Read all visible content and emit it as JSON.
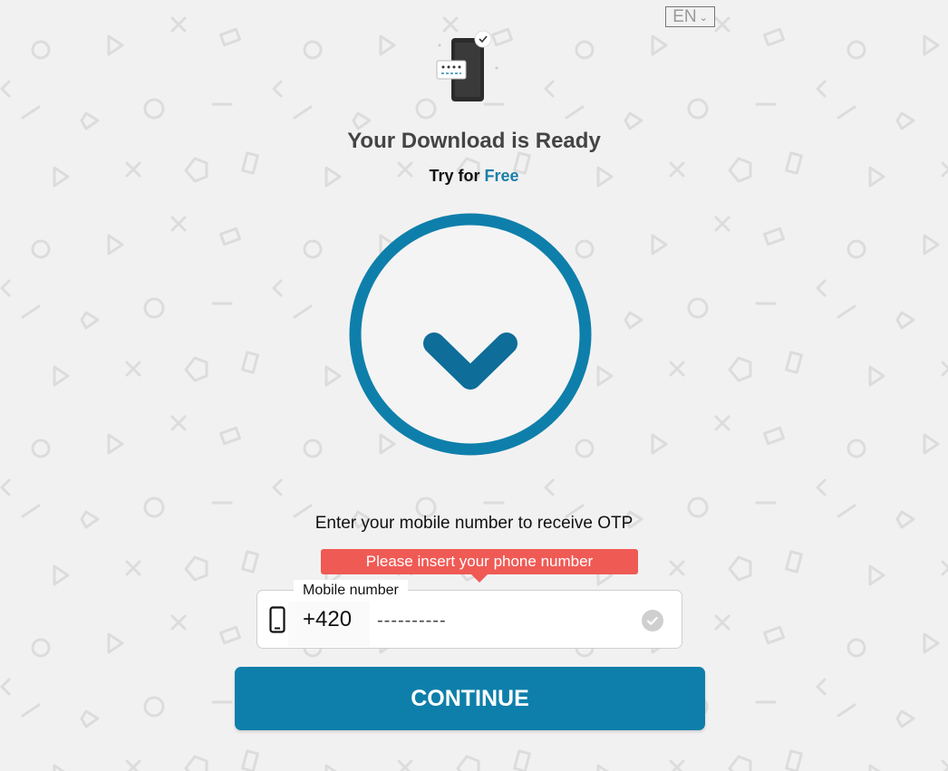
{
  "language": {
    "selected": "EN"
  },
  "header": {
    "title": "Your Download is Ready",
    "subtitle_prefix": "Try for",
    "subtitle_accent": "Free"
  },
  "form": {
    "prompt": "Enter your mobile number to receive OTP",
    "error_tooltip": "Please insert your phone number",
    "field_label": "Mobile number",
    "country_code": "+420",
    "number_placeholder": "----------",
    "number_value": ""
  },
  "continue_label": "CONTINUE",
  "colors": {
    "accent": "#1a7fa9",
    "button": "#0e7faa",
    "error": "#f05a55",
    "background": "#f2f1f2"
  },
  "icons": {
    "illustration": "phone-otp-illustration",
    "download": "download-arrow-icon",
    "device": "mobile-phone-icon",
    "validation": "check-circle-icon",
    "dropdown": "chevron-down-icon"
  }
}
